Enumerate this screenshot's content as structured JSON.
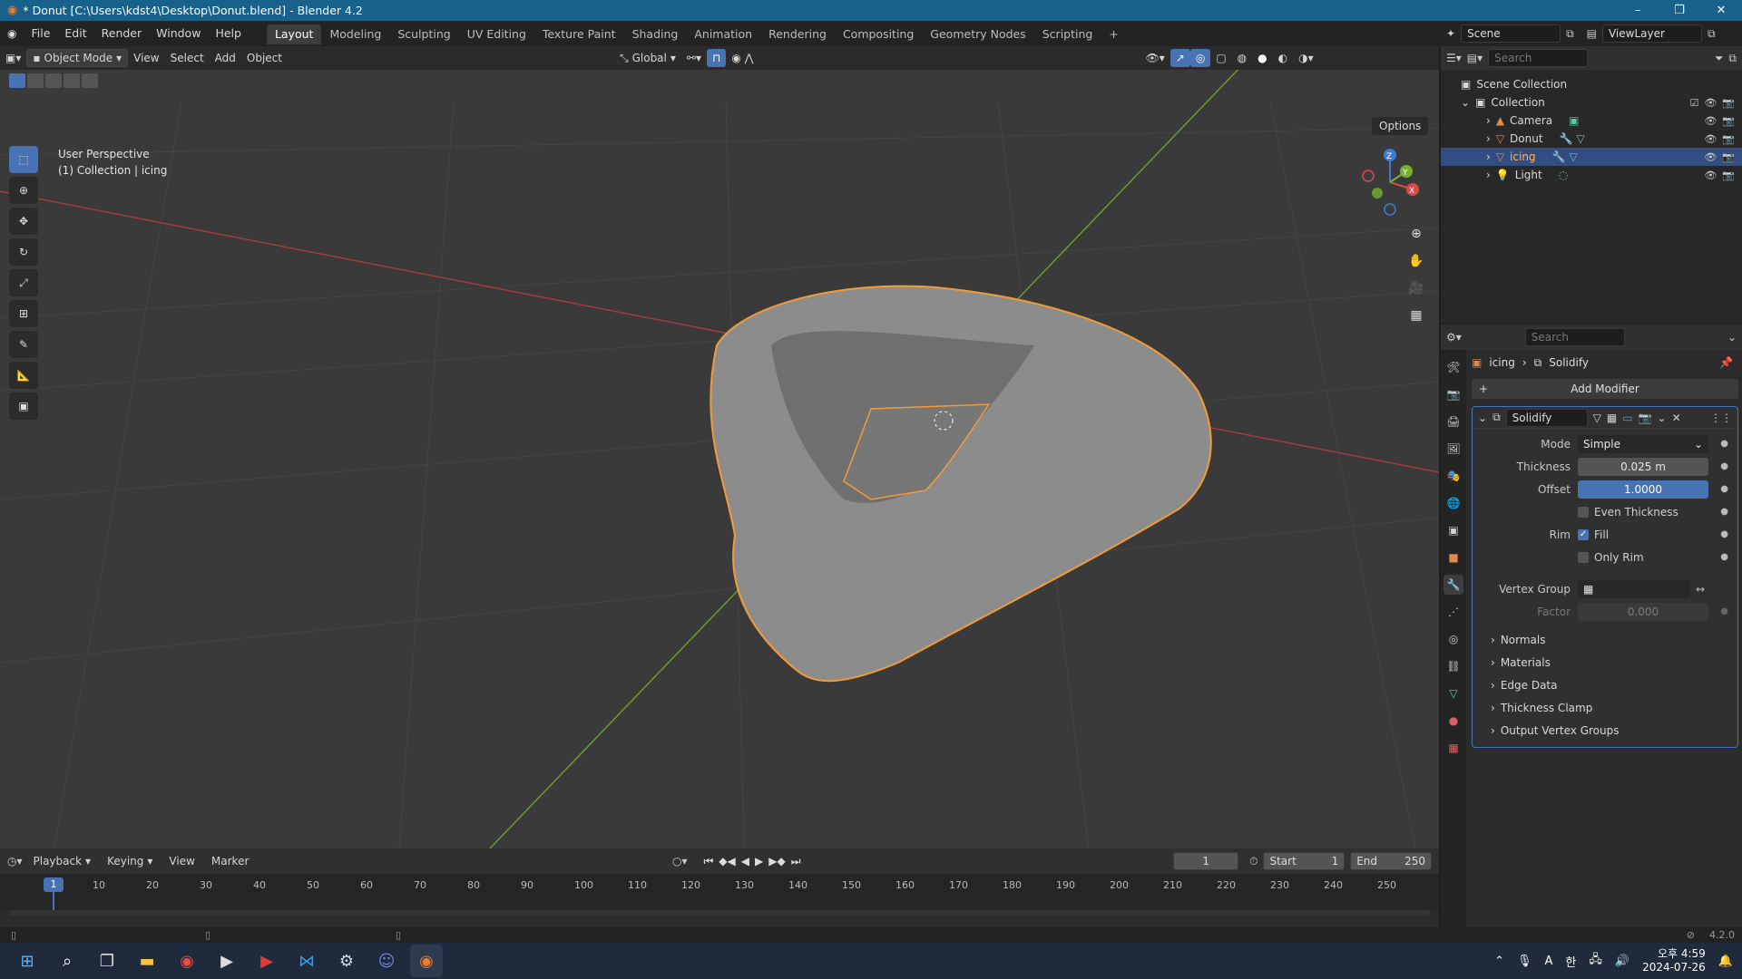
{
  "window": {
    "title": "* Donut [C:\\Users\\kdst4\\Desktop\\Donut.blend] - Blender 4.2",
    "min": "–",
    "max": "❐",
    "close": "✕"
  },
  "menu": [
    "File",
    "Edit",
    "Render",
    "Window",
    "Help"
  ],
  "workspaces": [
    "Layout",
    "Modeling",
    "Sculpting",
    "UV Editing",
    "Texture Paint",
    "Shading",
    "Animation",
    "Rendering",
    "Compositing",
    "Geometry Nodes",
    "Scripting"
  ],
  "workspace_add": "+",
  "scene": {
    "name": "Scene",
    "view_layer": "ViewLayer"
  },
  "viewport": {
    "mode": "Object Mode",
    "menus": [
      "View",
      "Select",
      "Add",
      "Object"
    ],
    "orientation": "Global",
    "options": "Options",
    "info_line1": "User Perspective",
    "info_line2": "(1) Collection | icing",
    "axes": {
      "x": "X",
      "y": "Y",
      "z": "Z"
    }
  },
  "outliner": {
    "search_placeholder": "Search",
    "root": "Scene Collection",
    "collection": "Collection",
    "items": [
      {
        "name": "Camera",
        "selected": false
      },
      {
        "name": "Donut",
        "selected": false
      },
      {
        "name": "icing",
        "selected": true
      },
      {
        "name": "Light",
        "selected": false
      }
    ]
  },
  "properties": {
    "search_placeholder": "Search",
    "object": "icing",
    "modifier_crumb": "Solidify",
    "add_modifier": "Add Modifier",
    "modifier": {
      "name": "Solidify",
      "mode_label": "Mode",
      "mode_value": "Simple",
      "thickness_label": "Thickness",
      "thickness_value": "0.025 m",
      "offset_label": "Offset",
      "offset_value": "1.0000",
      "even_thickness": "Even Thickness",
      "rim_label": "Rim",
      "fill": "Fill",
      "only_rim": "Only Rim",
      "vertex_group_label": "Vertex Group",
      "factor_label": "Factor",
      "factor_value": "0.000",
      "subpanels": [
        "Normals",
        "Materials",
        "Edge Data",
        "Thickness Clamp",
        "Output Vertex Groups"
      ]
    }
  },
  "timeline": {
    "menus": [
      "Playback",
      "Keying",
      "View",
      "Marker"
    ],
    "current_frame": "1",
    "start_label": "Start",
    "start": "1",
    "end_label": "End",
    "end": "250",
    "ticks": [
      "10",
      "20",
      "30",
      "40",
      "50",
      "60",
      "70",
      "80",
      "90",
      "100",
      "110",
      "120",
      "130",
      "140",
      "150",
      "160",
      "170",
      "180",
      "190",
      "200",
      "210",
      "220",
      "230",
      "240",
      "250"
    ]
  },
  "status": {
    "version": "4.2.0"
  },
  "taskbar": {
    "time": "오후 4:59",
    "date": "2024-07-26",
    "ime": "A",
    "lang": "한"
  },
  "colors": {
    "accent": "#4772b3",
    "selection_outline": "#f29c38",
    "x_axis": "#c94040",
    "y_axis": "#7aa830",
    "titlebar": "#17618a"
  }
}
